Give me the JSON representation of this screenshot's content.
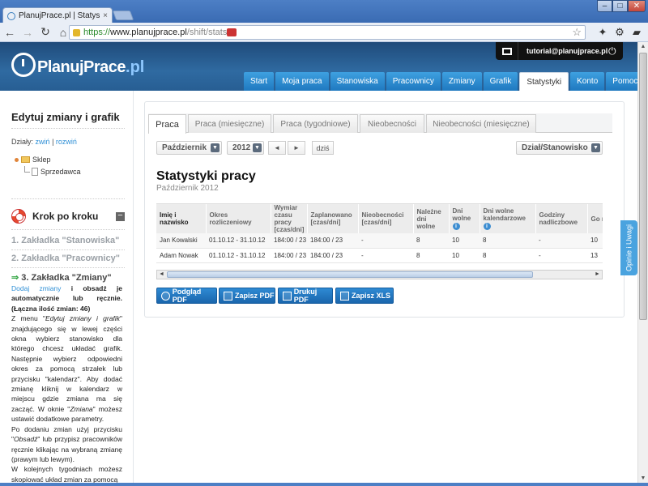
{
  "browser": {
    "tab_title": "PlanujPrace.pl | Statystyki",
    "tab_close": "×",
    "url_https": "https://",
    "url_host": "www.planujprace.pl",
    "url_path": "/shift/stats",
    "window_buttons": {
      "minimize": "–",
      "maximize": "□",
      "close": "✕"
    }
  },
  "header": {
    "logo_text": "PlanujPrace",
    "logo_tld": ".pl",
    "user_email": "tutorial@planujprace.pl",
    "nav": [
      {
        "label": "Start"
      },
      {
        "label": "Moja praca"
      },
      {
        "label": "Stanowiska"
      },
      {
        "label": "Pracownicy"
      },
      {
        "label": "Zmiany"
      },
      {
        "label": "Grafik"
      },
      {
        "label": "Statystyki",
        "active": true
      },
      {
        "label": "Konto"
      },
      {
        "label": "Pomoc"
      }
    ]
  },
  "sidebar": {
    "title": "Edytuj zmiany i grafik",
    "dzialy_label": "Działy:",
    "collapse_link": "zwiń",
    "separator": "|",
    "expand_link": "rozwiń",
    "tree": {
      "root": "Sklep",
      "child": "Sprzedawca"
    },
    "krok_title": "Krok po kroku",
    "collapse_button": "−",
    "steps": [
      "1. Zakładka \"Stanowiska\"",
      "2. Zakładka \"Pracownicy\"",
      "3. Zakładka \"Zmiany\""
    ],
    "help": {
      "link1": "Dodaj zmiany",
      "bold1": " i obsadź je automatycznie lub ręcznie. (Łączna ilość zmian: 46)",
      "p1a": "Z menu \"",
      "p1i": "Edytuj zmiany i grafik",
      "p1b": "\" znajdującego się w lewej części okna wybierz stanowisko dla którego chcesz układać grafik. Następnie wybierz odpowiedni okres za pomocą strzałek lub przycisku \"kalendarz\". Aby dodać zmianę kliknij w kalendarz w miejscu gdzie zmiana ma się zacząć. W oknie \"",
      "p1i2": "Zmiana",
      "p1c": "\" możesz ustawić dodatkowe parametry.",
      "p2a": "Po dodaniu zmian użyj przycisku \"",
      "p2i": "Obsadź",
      "p2b": "\" lub przypisz pracowników ręcznie klikając na wybraną zmianę (prawym lub lewym).",
      "p3": "W kolejnych tygodniach możesz skopiować układ zmian za pomocą"
    }
  },
  "content": {
    "tabs": [
      {
        "label": "Praca",
        "active": true
      },
      {
        "label": "Praca (miesięczne)"
      },
      {
        "label": "Praca (tygodniowe)"
      },
      {
        "label": "Nieobecności"
      },
      {
        "label": "Nieobecności (miesięczne)"
      }
    ],
    "month_select": "Październik",
    "year_select": "2012",
    "prev": "◄",
    "next": "►",
    "today": "dziś",
    "group_select": "Dział/Stanowisko",
    "title": "Statystyki pracy",
    "subtitle": "Październik 2012",
    "columns": [
      "Imię i nazwisko",
      "Okres rozliczeniowy",
      "Wymiar czasu pracy [czas/dni]",
      "Zaplanowano [czas/dni]",
      "Nieobecności [czas/dni]",
      "Należne dni wolne",
      "Dni wolne",
      "Dni wolne kalendarzowe",
      "Godziny nadliczbowe",
      "Go nc"
    ],
    "rows": [
      [
        "Jan Kowalski",
        "01.10.12 - 31.10.12",
        "184:00 / 23",
        "184:00 / 23",
        "-",
        "8",
        "10",
        "8",
        "-",
        "10"
      ],
      [
        "Adam Nowak",
        "01.10.12 - 31.10.12",
        "184:00 / 23",
        "184:00 / 23",
        "-",
        "8",
        "10",
        "8",
        "-",
        "13"
      ]
    ],
    "buttons": {
      "preview_pdf": "Podgląd PDF",
      "save_pdf": "Zapisz PDF",
      "print_pdf": "Drukuj PDF",
      "save_xls": "Zapisz XLS"
    },
    "feedback": "Opinie i Uwagi"
  }
}
